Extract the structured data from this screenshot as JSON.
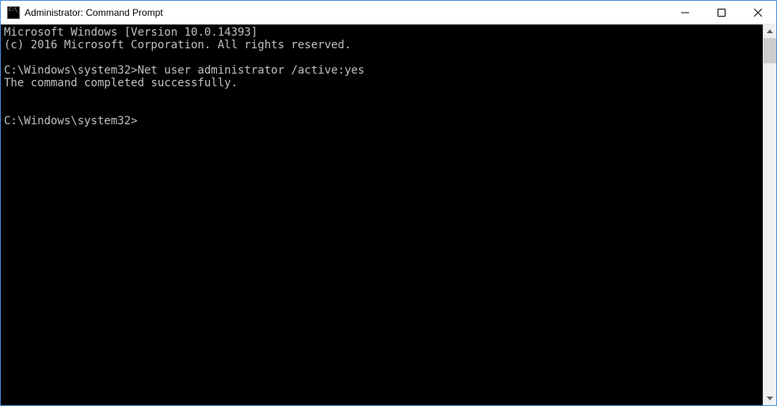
{
  "window": {
    "title": "Administrator: Command Prompt"
  },
  "terminal": {
    "line1": "Microsoft Windows [Version 10.0.14393]",
    "line2": "(c) 2016 Microsoft Corporation. All rights reserved.",
    "blank1": "",
    "prompt1_path": "C:\\Windows\\system32>",
    "prompt1_cmd": "Net user administrator /active:yes",
    "result1": "The command completed successfully.",
    "blank2": "",
    "blank3": "",
    "prompt2_path": "C:\\Windows\\system32>"
  }
}
